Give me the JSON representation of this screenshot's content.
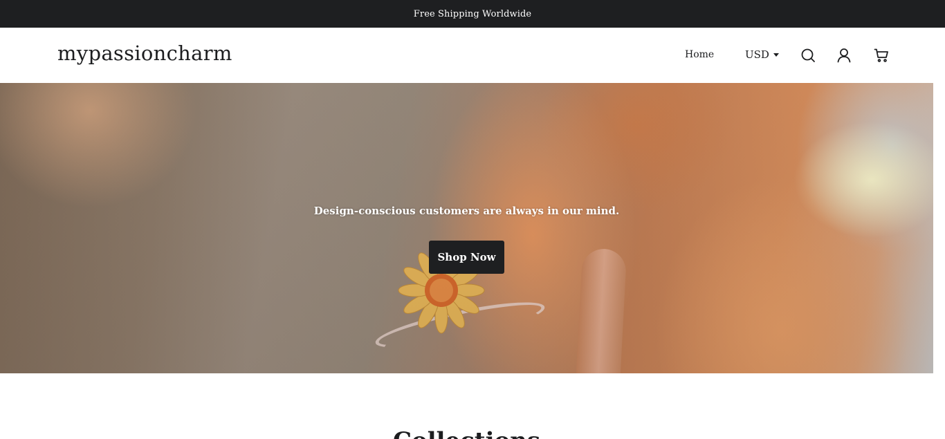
{
  "announcement": {
    "text": "Free Shipping Worldwide"
  },
  "header": {
    "logo": "mypassioncharm",
    "nav": {
      "home": "Home"
    },
    "currency": {
      "selected": "USD"
    },
    "icons": {
      "search": "search-icon",
      "account": "user-icon",
      "cart": "cart-icon"
    }
  },
  "hero": {
    "caption": "Design-conscious customers are always in our mind.",
    "button_label": "Shop Now"
  },
  "collections": {
    "heading": "Collections"
  },
  "colors": {
    "announcement_bg": "#1e1f21",
    "text": "#1c1d1f",
    "button_bg": "#1e1f21",
    "button_text": "#ffffff"
  }
}
